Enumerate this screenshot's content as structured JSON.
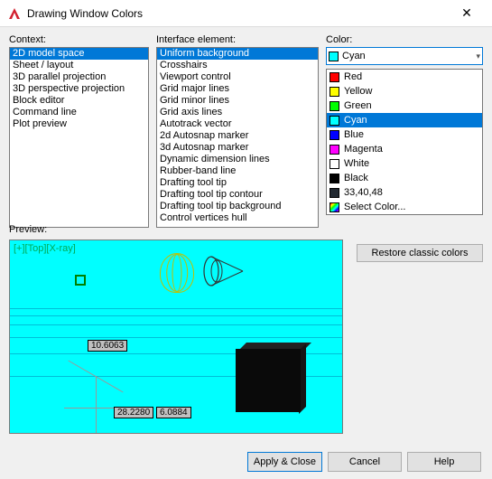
{
  "window": {
    "title": "Drawing Window Colors"
  },
  "labels": {
    "context": "Context:",
    "interface": "Interface element:",
    "color": "Color:",
    "preview": "Preview:"
  },
  "context": {
    "items": [
      "2D model space",
      "Sheet / layout",
      "3D parallel projection",
      "3D perspective projection",
      "Block editor",
      "Command line",
      "Plot preview"
    ],
    "selected": 0
  },
  "interface": {
    "items": [
      "Uniform background",
      "Crosshairs",
      "Viewport control",
      "Grid major lines",
      "Grid minor lines",
      "Grid axis lines",
      "Autotrack vector",
      "2d Autosnap marker",
      "3d Autosnap marker",
      "Dynamic dimension lines",
      "Rubber-band line",
      "Drafting tool tip",
      "Drafting tool tip contour",
      "Drafting tool tip background",
      "Control vertices hull"
    ],
    "selected": 0
  },
  "color": {
    "selected_label": "Cyan",
    "selected_swatch": "#00ffff",
    "options": [
      {
        "label": "Red",
        "swatch": "#ff0000"
      },
      {
        "label": "Yellow",
        "swatch": "#ffff00"
      },
      {
        "label": "Green",
        "swatch": "#00ff00"
      },
      {
        "label": "Cyan",
        "swatch": "#00ffff",
        "selected": true
      },
      {
        "label": "Blue",
        "swatch": "#0000ff"
      },
      {
        "label": "Magenta",
        "swatch": "#ff00ff"
      },
      {
        "label": "White",
        "swatch": "#ffffff"
      },
      {
        "label": "Black",
        "swatch": "#000000"
      },
      {
        "label": "33,40,48",
        "swatch": "#212830"
      },
      {
        "label": "Select Color...",
        "swatch": "gradient"
      }
    ],
    "restore_label": "Restore classic colors"
  },
  "preview": {
    "toptext": "[+][Top][X-ray]",
    "coord1": "10.6063",
    "coord2": "28.2280",
    "coord3": "6.0884"
  },
  "buttons": {
    "apply": "Apply & Close",
    "cancel": "Cancel",
    "help": "Help"
  }
}
